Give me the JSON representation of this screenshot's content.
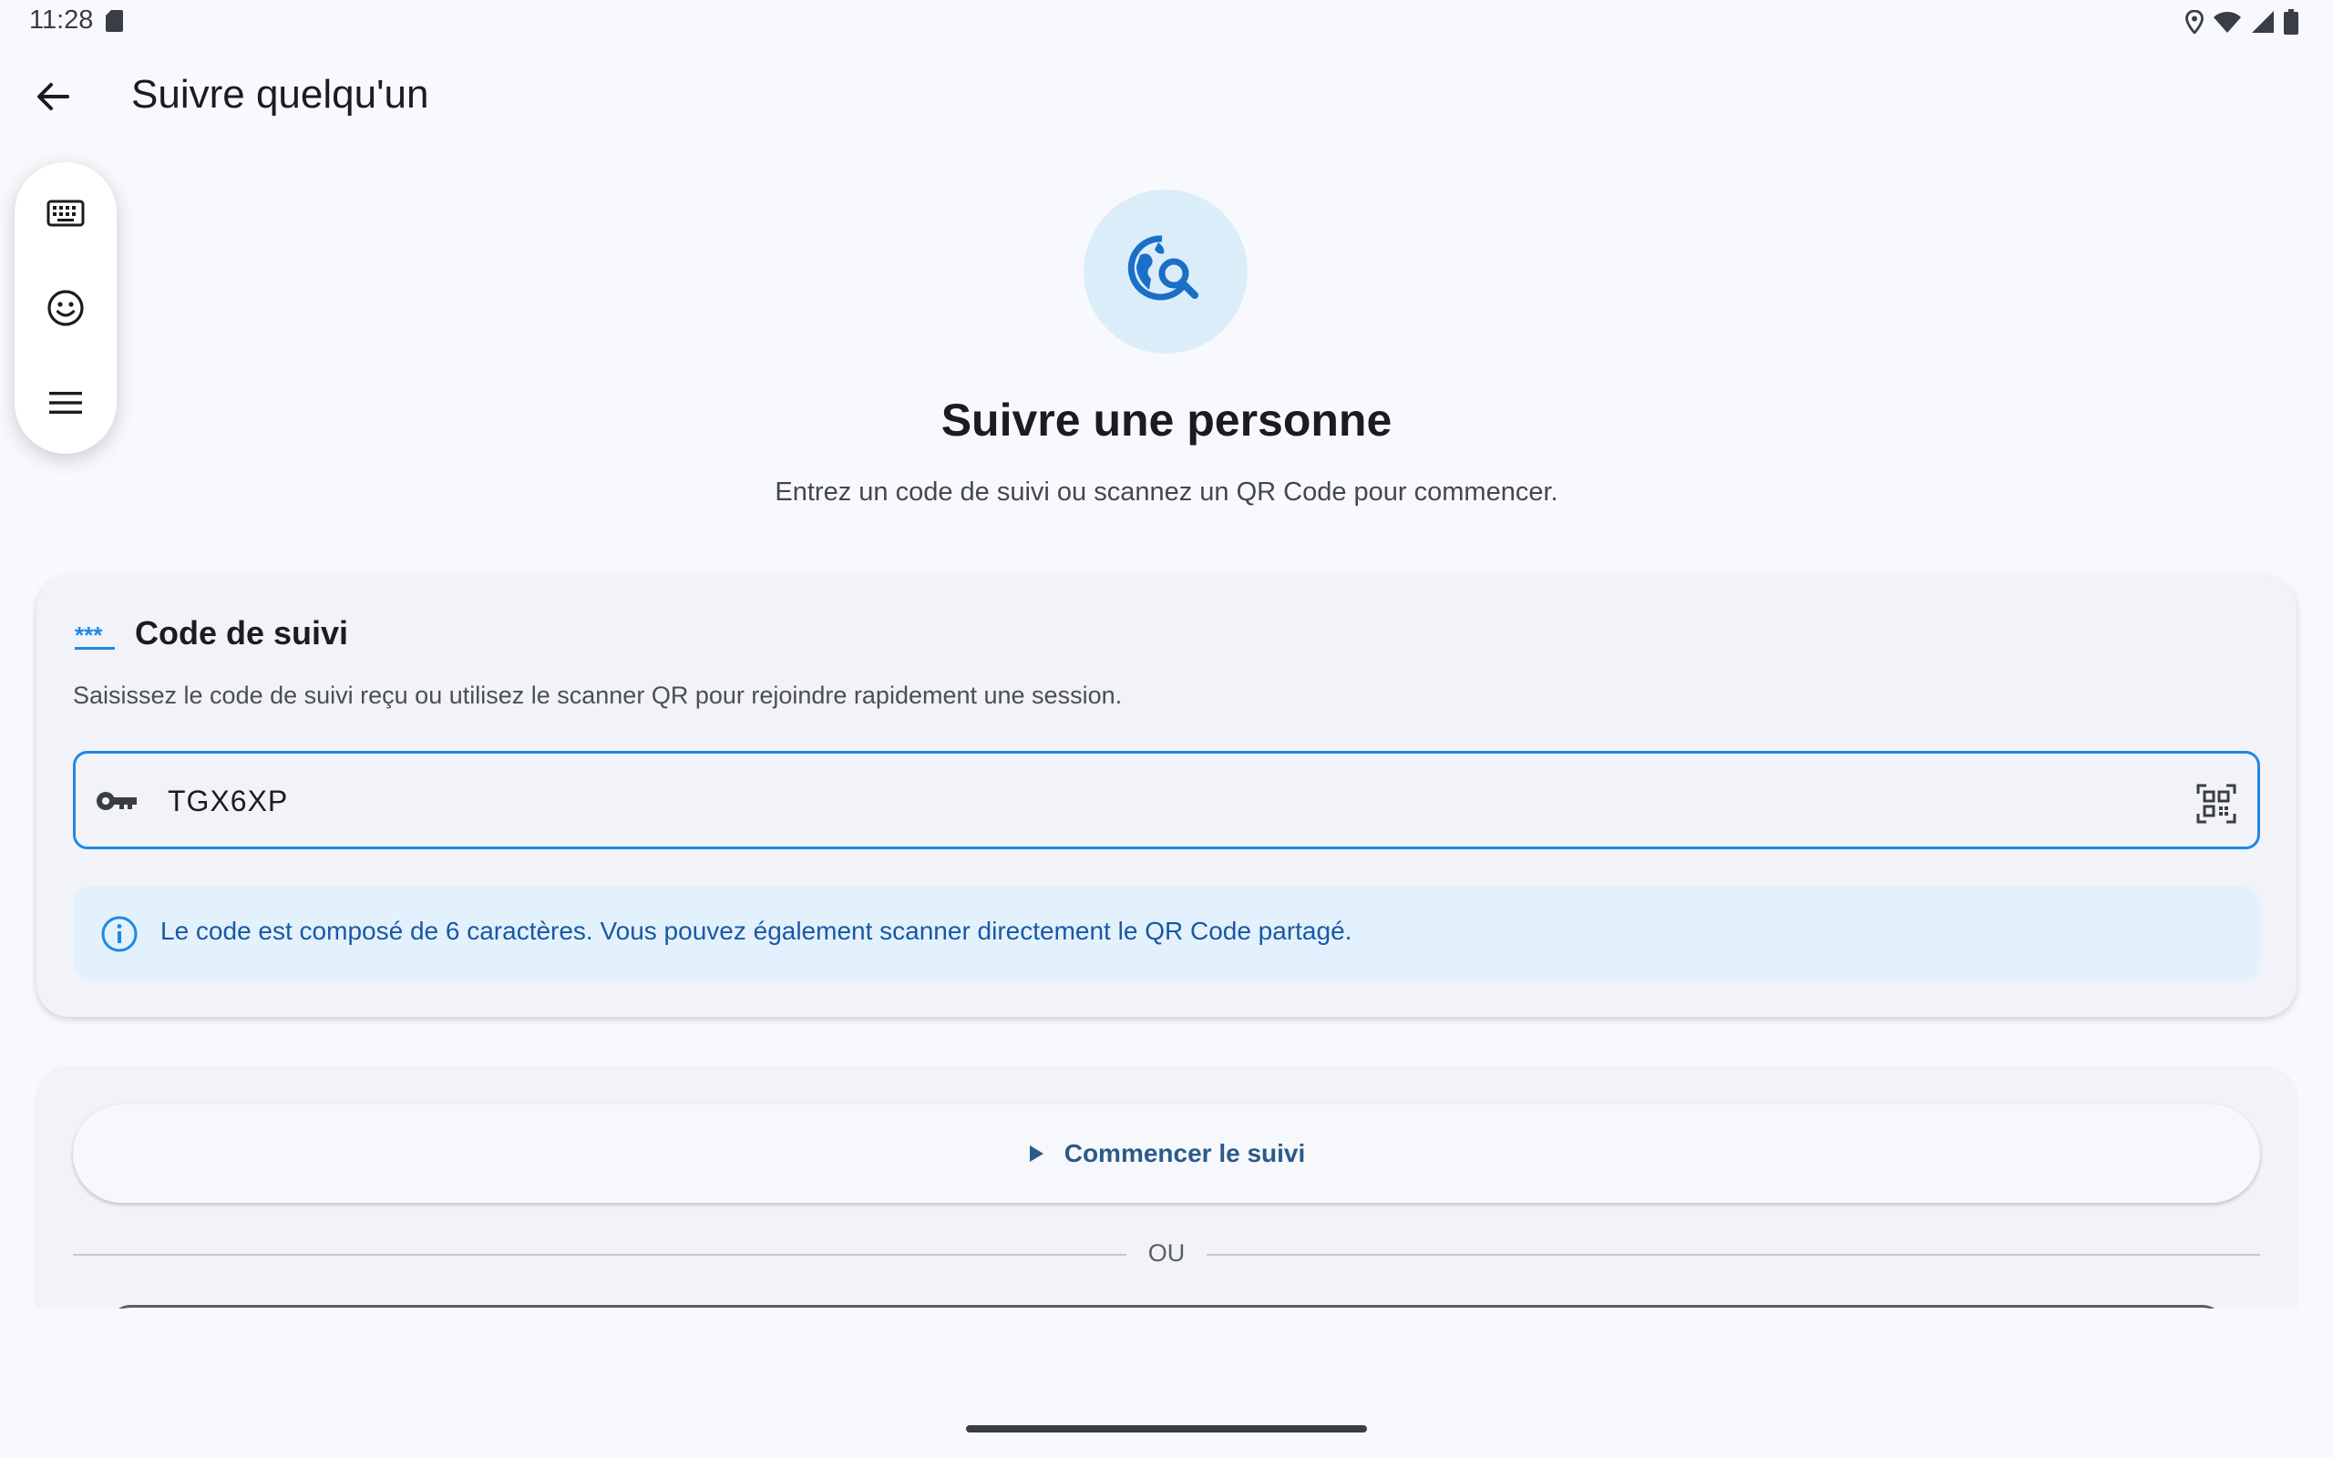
{
  "status_bar": {
    "time": "11:28"
  },
  "app_bar": {
    "title": "Suivre quelqu'un"
  },
  "hero": {
    "title": "Suivre une personne",
    "subtitle": "Entrez un code de suivi ou scannez un QR Code pour commencer."
  },
  "code_card": {
    "title": "Code de suivi",
    "description": "Saisissez le code de suivi reçu ou utilisez le scanner QR pour rejoindre rapidement une session.",
    "input_value": "TGX6XP",
    "info": "Le code est composé de 6 caractères. Vous pouvez également scanner directement le QR Code partagé."
  },
  "actions": {
    "start_label": "Commencer le suivi",
    "or_label": "OU"
  },
  "colors": {
    "accent": "#1e88e5",
    "info_background": "#e3f1fc",
    "info_text": "#1958a6",
    "hero_circle": "#dcedfa"
  },
  "icons": {
    "status": [
      "sd-card-icon",
      "location-icon",
      "wifi-icon",
      "signal-icon",
      "battery-icon"
    ],
    "toolbar": [
      "keyboard-icon",
      "emoji-icon",
      "menu-icon"
    ]
  }
}
